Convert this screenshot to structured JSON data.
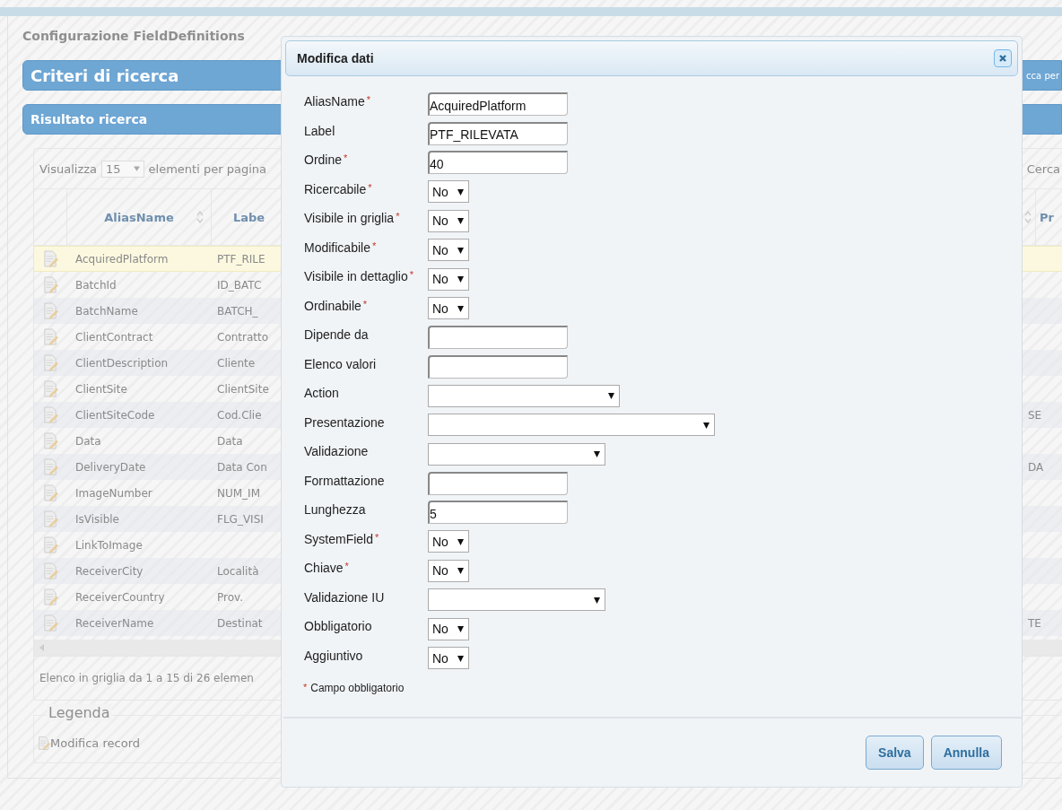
{
  "page": {
    "title": "Configurazione FieldDefinitions",
    "search_section": "Criteri di ricerca",
    "search_hint": "cca per",
    "results_section": "Risultato ricerca"
  },
  "grid": {
    "page_size_label": "Visualizza",
    "page_size": "15",
    "page_size_suffix": "elementi per pagina",
    "search_label": "Cerca",
    "columns": [
      {
        "label": "AliasName",
        "sortable": true
      },
      {
        "label": "Labe",
        "sortable": true
      },
      {
        "label": "Pr"
      }
    ],
    "rows": [
      {
        "alias": "AcquiredPlatform",
        "label": "PTF_RILE",
        "selected": true
      },
      {
        "alias": "BatchId",
        "label": "ID_BATC",
        "selected": false
      },
      {
        "alias": "BatchName",
        "label": "BATCH_",
        "selected": false
      },
      {
        "alias": "ClientContract",
        "label": "Contratto",
        "selected": false
      },
      {
        "alias": "ClientDescription",
        "label": "Cliente",
        "selected": false
      },
      {
        "alias": "ClientSite",
        "label": "ClientSite",
        "selected": false
      },
      {
        "alias": "ClientSiteCode",
        "label": "Cod.Clie",
        "column_3": "SE",
        "selected": false
      },
      {
        "alias": "Data",
        "label": "Data",
        "selected": false
      },
      {
        "alias": "DeliveryDate",
        "label": "Data Con",
        "column_3": "DA",
        "selected": false
      },
      {
        "alias": "ImageNumber",
        "label": "NUM_IM",
        "selected": false
      },
      {
        "alias": "IsVisible",
        "label": "FLG_VISI",
        "selected": false
      },
      {
        "alias": "LinkToImage",
        "selected": false
      },
      {
        "alias": "ReceiverCity",
        "label": "Località",
        "selected": false
      },
      {
        "alias": "ReceiverCountry",
        "label": "Prov.",
        "selected": false
      },
      {
        "alias": "ReceiverName",
        "label": "Destinat",
        "column_3": "TE",
        "selected": false
      }
    ],
    "summary": "Elenco in griglia da 1 a 15 di 26 elemen"
  },
  "legend": {
    "title": "Legenda",
    "items": [
      "Modifica record"
    ]
  },
  "dialog": {
    "title": "Modifica dati",
    "fields": [
      {
        "label": "AliasName",
        "required": true,
        "kind": "text",
        "value": "AcquiredPlatform"
      },
      {
        "label": "Label",
        "required": false,
        "kind": "text",
        "value": "PTF_RILEVATA"
      },
      {
        "label": "Ordine",
        "required": true,
        "kind": "text",
        "value": "40"
      },
      {
        "label": "Ricercabile",
        "required": true,
        "kind": "choice",
        "value": "No"
      },
      {
        "label": "Visibile in griglia",
        "required": true,
        "kind": "choice",
        "value": "No"
      },
      {
        "label": "Modificabile",
        "required": true,
        "kind": "choice",
        "value": "No"
      },
      {
        "label": "Visibile in dettaglio",
        "required": true,
        "kind": "choice",
        "value": "No"
      },
      {
        "label": "Ordinabile",
        "required": true,
        "kind": "choice",
        "value": "No"
      },
      {
        "label": "Dipende da",
        "required": false,
        "kind": "text"
      },
      {
        "label": "Elenco valori",
        "required": false,
        "kind": "text"
      },
      {
        "label": "Action",
        "required": false,
        "kind": "longlist"
      },
      {
        "label": "Presentazione",
        "required": false,
        "kind": "widelist"
      },
      {
        "label": "Validazione",
        "required": false,
        "kind": "list"
      },
      {
        "label": "Formattazione",
        "required": false,
        "kind": "text"
      },
      {
        "label": "Lunghezza",
        "required": false,
        "kind": "text",
        "value": "5"
      },
      {
        "label": "SystemField",
        "required": true,
        "kind": "choice",
        "value": "No"
      },
      {
        "label": "Chiave",
        "required": true,
        "kind": "choice",
        "value": "No"
      },
      {
        "label": "Validazione IU",
        "required": false,
        "kind": "list"
      },
      {
        "label": "Obbligatorio",
        "required": false,
        "kind": "choice",
        "value": "No"
      },
      {
        "label": "Aggiuntivo",
        "required": false,
        "kind": "choice",
        "value": "No"
      }
    ],
    "required_mark": "*",
    "note": "Campo obbligatorio",
    "buttons": [
      "Salva",
      "Annulla"
    ]
  }
}
